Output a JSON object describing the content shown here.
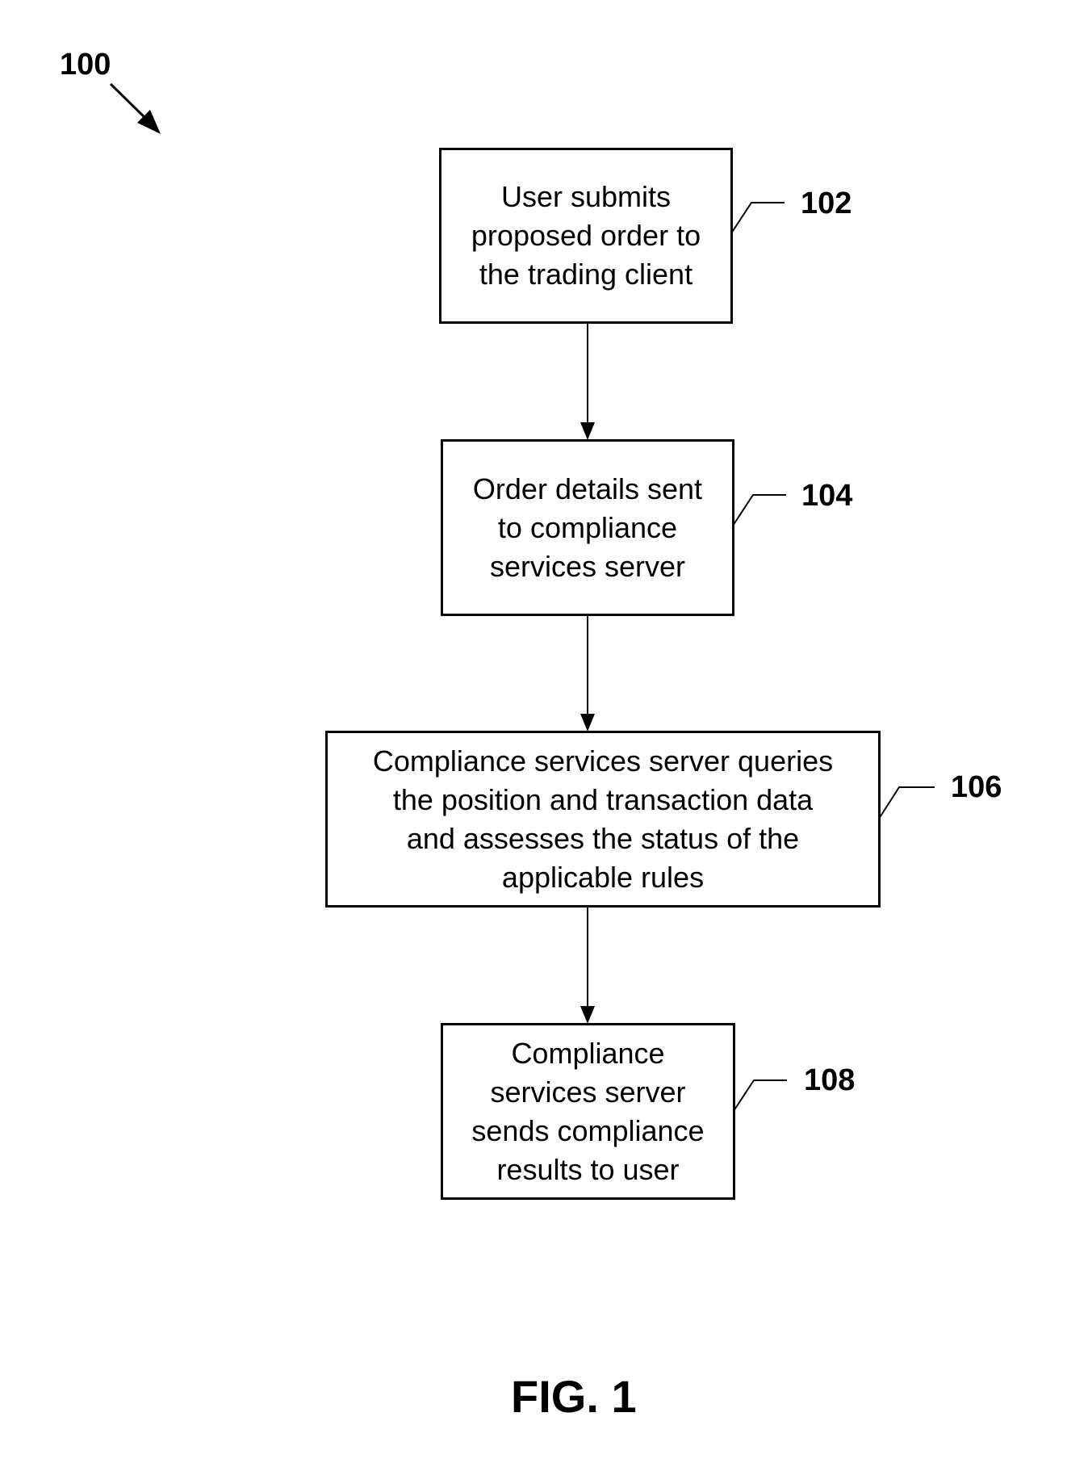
{
  "figure": {
    "reference_number": "100",
    "caption": "FIG. 1"
  },
  "steps": [
    {
      "ref": "102",
      "text": "User submits\nproposed order to\nthe trading client"
    },
    {
      "ref": "104",
      "text": "Order details sent\nto compliance\nservices server"
    },
    {
      "ref": "106",
      "text": "Compliance services server queries\nthe position and transaction data\nand assesses the status of the\napplicable rules"
    },
    {
      "ref": "108",
      "text": "Compliance\nservices server\nsends compliance\nresults to user"
    }
  ]
}
